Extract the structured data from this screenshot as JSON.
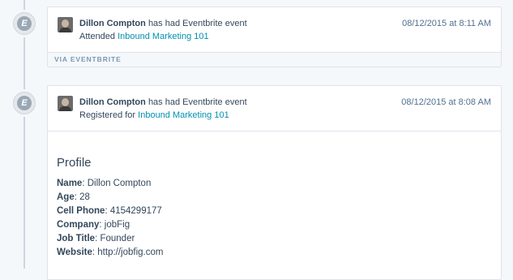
{
  "events": [
    {
      "badge_letter": "E",
      "actor": "Dillon Compton",
      "action_text": "has had Eventbrite event",
      "detail_prefix": "Attended",
      "detail_link": "Inbound Marketing 101",
      "timestamp": "08/12/2015 at 8:11 AM",
      "source": "VIA EVENTBRITE"
    },
    {
      "badge_letter": "E",
      "actor": "Dillon Compton",
      "action_text": "has had Eventbrite event",
      "detail_prefix": "Registered for",
      "detail_link": "Inbound Marketing 101",
      "timestamp": "08/12/2015 at 8:08 AM",
      "profile": {
        "title": "Profile",
        "fields": [
          {
            "label": "Name",
            "value": "Dillon Compton"
          },
          {
            "label": "Age",
            "value": "28"
          },
          {
            "label": "Cell Phone",
            "value": "4154299177"
          },
          {
            "label": "Company",
            "value": "jobFig"
          },
          {
            "label": "Job Title",
            "value": "Founder"
          },
          {
            "label": "Website",
            "value": "http://jobfig.com"
          }
        ]
      }
    }
  ],
  "colors": {
    "link": "#0091ae",
    "text": "#33475b",
    "muted": "#7c98b6",
    "background": "#f5f8fa"
  }
}
